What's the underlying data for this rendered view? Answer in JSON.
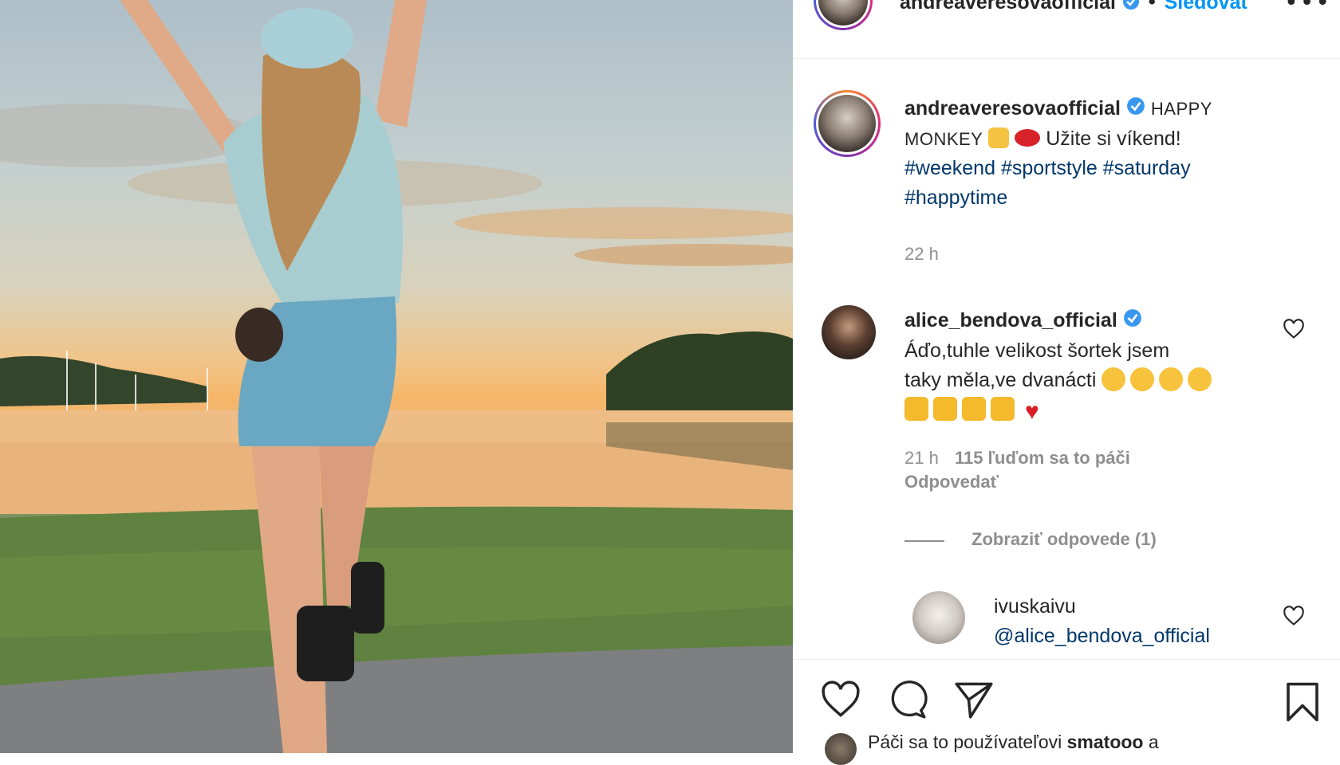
{
  "post_author": {
    "username": "andreaveresovaofficial",
    "follow_label": "Sledovať"
  },
  "caption": {
    "username": "andreaveresovaofficial",
    "text_caps": "HAPPY MONKEY",
    "text": "Užite si víkend!",
    "hashtags": [
      "#weekend",
      "#sportstyle",
      "#saturday",
      "#happytime"
    ],
    "time": "22 h"
  },
  "comments": [
    {
      "username": "alice_bendova_official",
      "text_line1": "Áďo,tuhle velikost šortek jsem",
      "text_line2": "taky měla,ve dvanácti",
      "time": "21 h",
      "likes": "115 ľuďom sa to páči",
      "reply_label": "Odpovedať",
      "view_replies": "Zobraziť odpovede (1)"
    },
    {
      "username": "ivuskaivu",
      "text": "@alice_bendova_official"
    }
  ],
  "likes_line": {
    "prefix": "Páči sa to používateľovi",
    "user": "smatooo",
    "suffix": "a"
  },
  "colors": {
    "link": "#00376b",
    "verified": "#3897f0",
    "muted": "#8e8e8e"
  }
}
